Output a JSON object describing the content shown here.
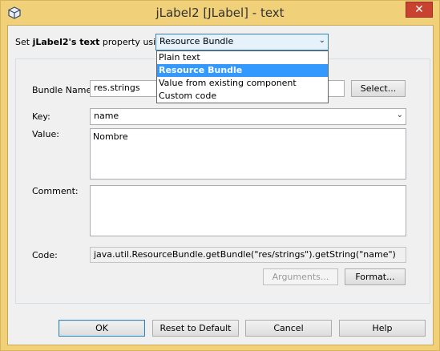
{
  "window": {
    "title": "jLabel2 [JLabel] - text",
    "close": "✕",
    "accent": "#f0d078"
  },
  "header": {
    "prefix": "Set ",
    "bean": "jLabel2",
    "mid": "'s ",
    "property": "text",
    "suffix": " property using:",
    "mode_value": "Resource Bundle"
  },
  "dropdown": {
    "options": [
      "Plain text",
      "Resource Bundle",
      "Value from existing component",
      "Custom code"
    ],
    "selected": "Resource Bundle"
  },
  "form": {
    "bundle_label": "Bundle Name:",
    "bundle_value": "res.strings",
    "select_button": "Select...",
    "key_label": "Key:",
    "key_value": "name",
    "value_label": "Value:",
    "value_text": "Nombre",
    "comment_label": "Comment:",
    "comment_text": "",
    "code_label": "Code:",
    "code_value": "java.util.ResourceBundle.getBundle(\"res/strings\").getString(\"name\")",
    "arguments_button": "Arguments...",
    "format_button": "Format..."
  },
  "footer": {
    "ok": "OK",
    "reset": "Reset to Default",
    "cancel": "Cancel",
    "help": "Help"
  }
}
